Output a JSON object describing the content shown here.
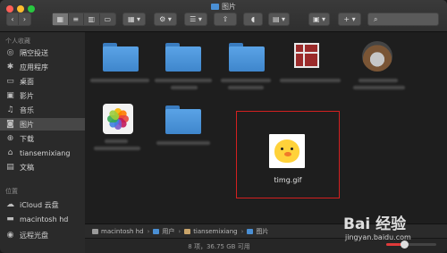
{
  "window": {
    "title": "图片"
  },
  "sidebar": {
    "favorites_header": "个人收藏",
    "favorites": [
      {
        "label": "隔空投送",
        "icon": "airdrop-icon"
      },
      {
        "label": "应用程序",
        "icon": "applications-icon"
      },
      {
        "label": "桌面",
        "icon": "desktop-icon"
      },
      {
        "label": "影片",
        "icon": "movies-icon"
      },
      {
        "label": "音乐",
        "icon": "music-icon"
      },
      {
        "label": "图片",
        "icon": "pictures-icon",
        "selected": true
      },
      {
        "label": "下载",
        "icon": "downloads-icon"
      },
      {
        "label": "tiansemixiang",
        "icon": "home-icon"
      },
      {
        "label": "文稿",
        "icon": "documents-icon"
      }
    ],
    "locations_header": "位置",
    "locations": [
      {
        "label": "iCloud 云盘",
        "icon": "icloud-icon"
      },
      {
        "label": "macintosh hd",
        "icon": "disk-icon"
      },
      {
        "label": "远程光盘",
        "icon": "remote-disc-icon"
      }
    ]
  },
  "content": {
    "selected_file": {
      "name": "timg.gif"
    }
  },
  "pathbar": [
    "macintosh hd",
    "用户",
    "tiansemixiang",
    "图片"
  ],
  "status": {
    "text": "8 项，36.75 GB 可用"
  },
  "zoom": {
    "level": 0.35
  },
  "watermark": {
    "main": "Bai 经验",
    "sub": "jingyan.baidu.com"
  },
  "colors": {
    "accent": "#4a8fd4",
    "selection_border": "#d42020"
  }
}
